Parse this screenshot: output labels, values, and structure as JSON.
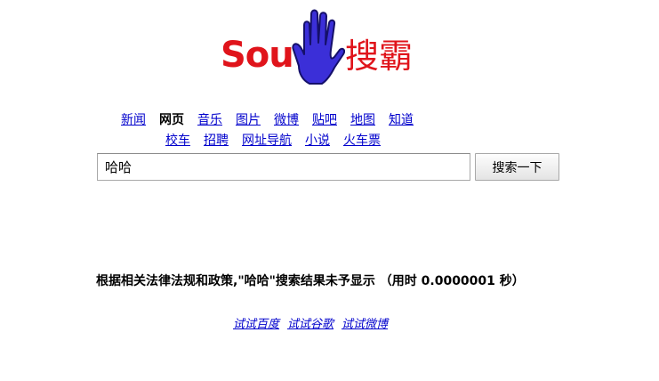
{
  "logo": {
    "latin": "Sou",
    "chinese": "搜霸",
    "hand_icon": "blue-hand-icon",
    "colors": {
      "text": "#e0141b",
      "hand": "#3b2fd8"
    }
  },
  "nav": {
    "row1": [
      {
        "label": "新闻",
        "current": false
      },
      {
        "label": "网页",
        "current": true
      },
      {
        "label": "音乐",
        "current": false
      },
      {
        "label": "图片",
        "current": false
      },
      {
        "label": "微博",
        "current": false
      },
      {
        "label": "贴吧",
        "current": false
      },
      {
        "label": "地图",
        "current": false
      },
      {
        "label": "知道",
        "current": false
      }
    ],
    "row2": [
      {
        "label": "校车"
      },
      {
        "label": "招聘"
      },
      {
        "label": "网址导航"
      },
      {
        "label": "小说"
      },
      {
        "label": "火车票"
      }
    ]
  },
  "search": {
    "value": "哈哈",
    "button_label": "搜索一下"
  },
  "notice": {
    "text": "根据相关法律法规和政策,\"哈哈\"搜索结果未予显示 （用时 0.0000001 秒）"
  },
  "try_links": [
    "试试百度",
    "试试谷歌",
    "试试微博"
  ],
  "colors": {
    "link": "#0000cc",
    "brand_red": "#e0141b"
  }
}
